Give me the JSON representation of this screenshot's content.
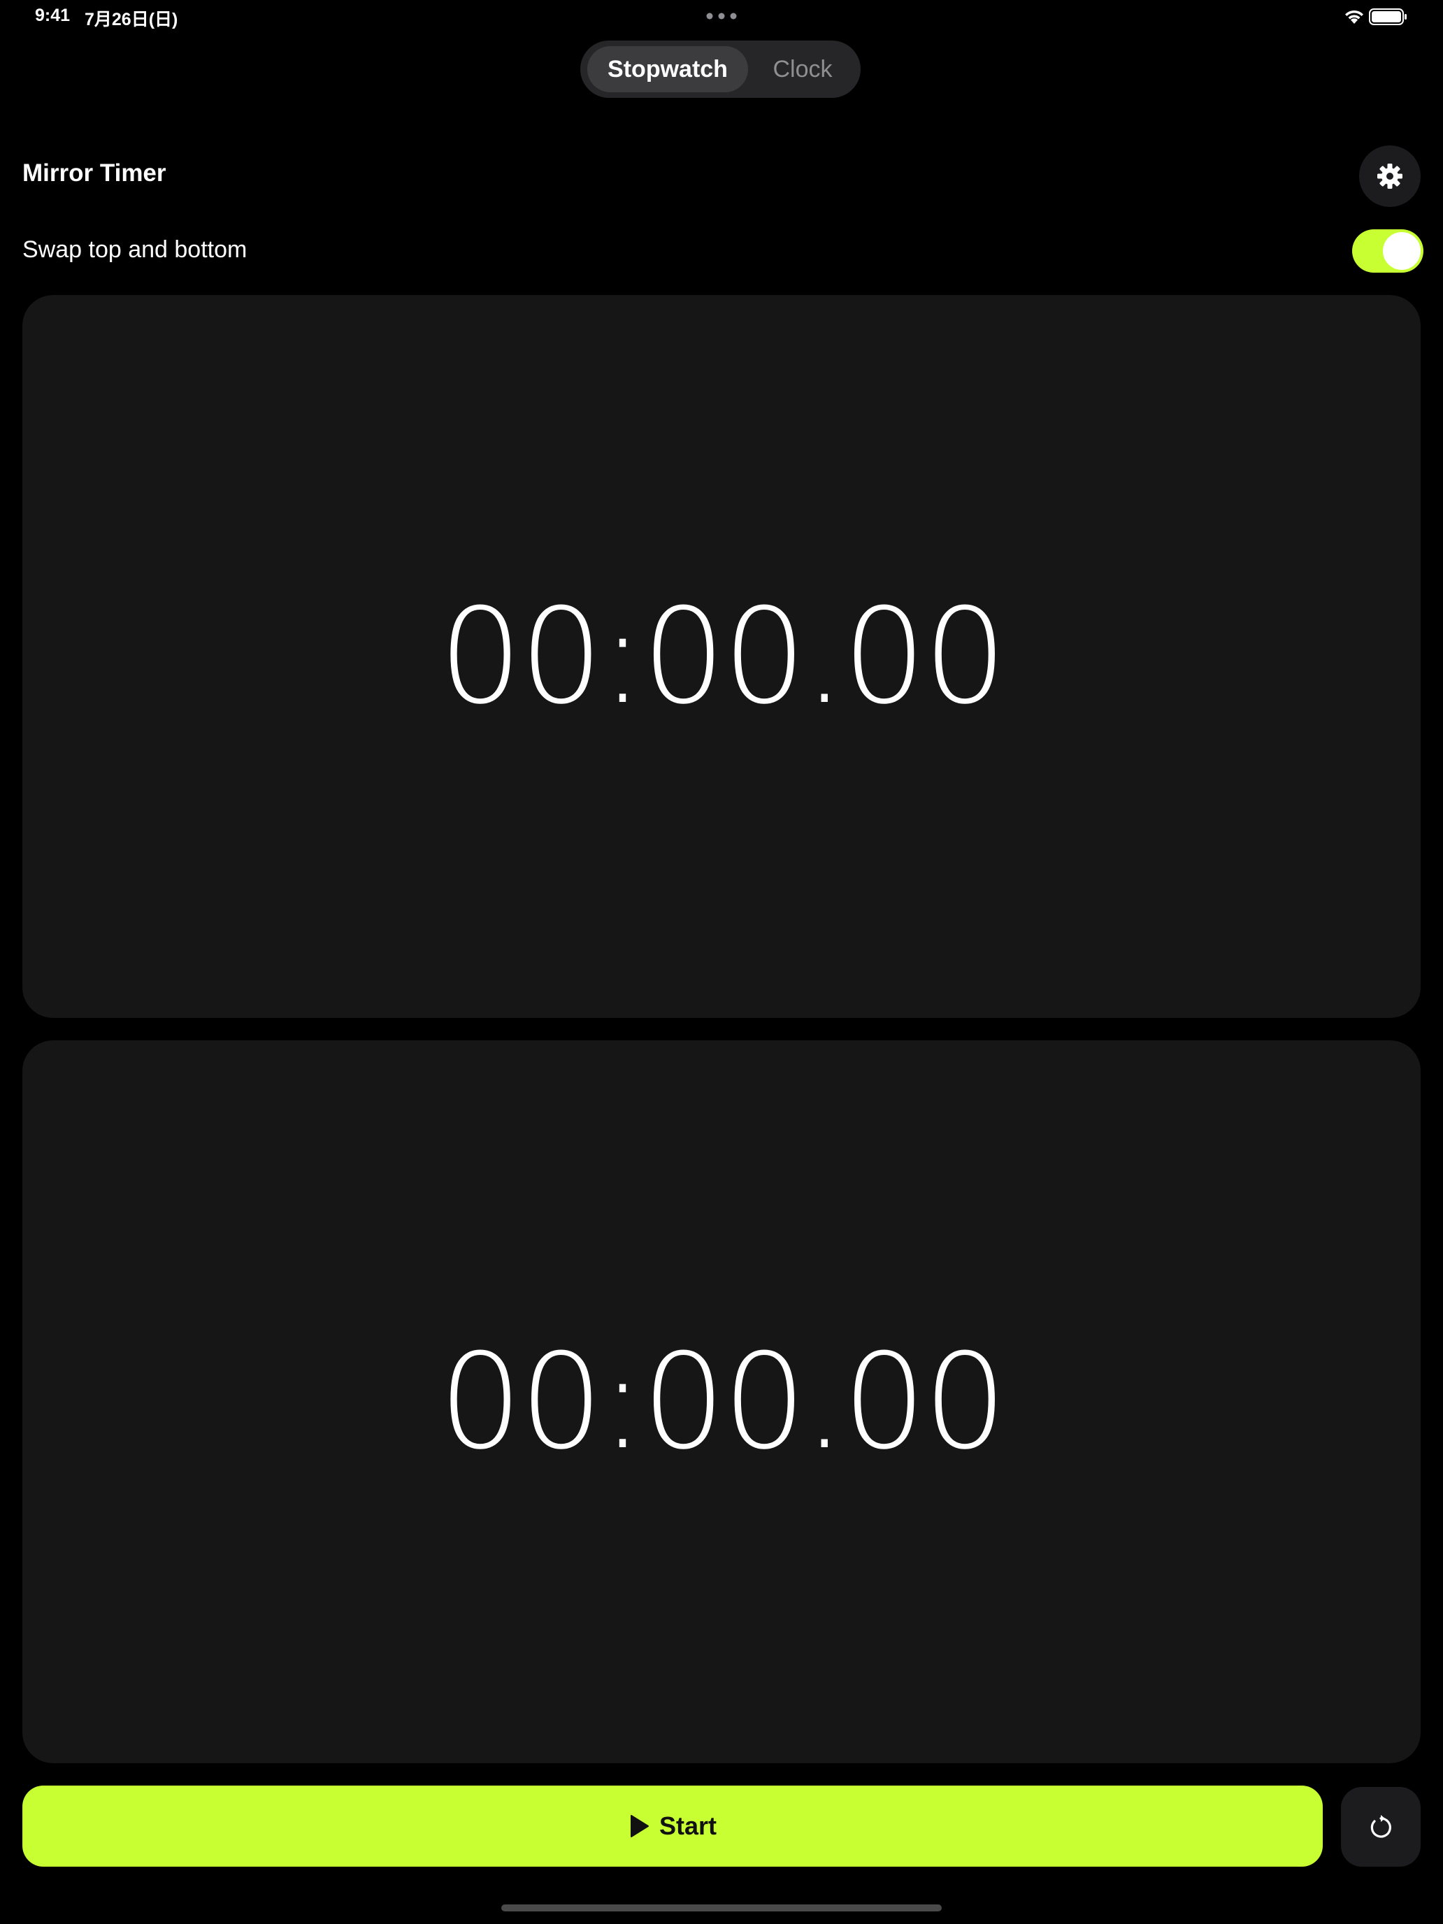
{
  "status_bar": {
    "time": "9:41",
    "date": "7月26日(日)",
    "icons": [
      "multitask-dots-icon",
      "wifi-icon",
      "battery-icon"
    ]
  },
  "mode_switch": {
    "options": [
      "Stopwatch",
      "Clock"
    ],
    "selected": "Stopwatch"
  },
  "header": {
    "title": "Mirror Timer",
    "settings_icon": "gear-icon"
  },
  "swap": {
    "label": "Swap top and bottom",
    "enabled": true
  },
  "timers": {
    "top": "00:00.00",
    "bottom": "00:00.00"
  },
  "controls": {
    "start_label": "Start",
    "start_icon": "play-icon",
    "reset_icon": "reset-icon"
  },
  "colors": {
    "accent": "#c8ff33",
    "background": "#000000",
    "panel": "#161616"
  }
}
